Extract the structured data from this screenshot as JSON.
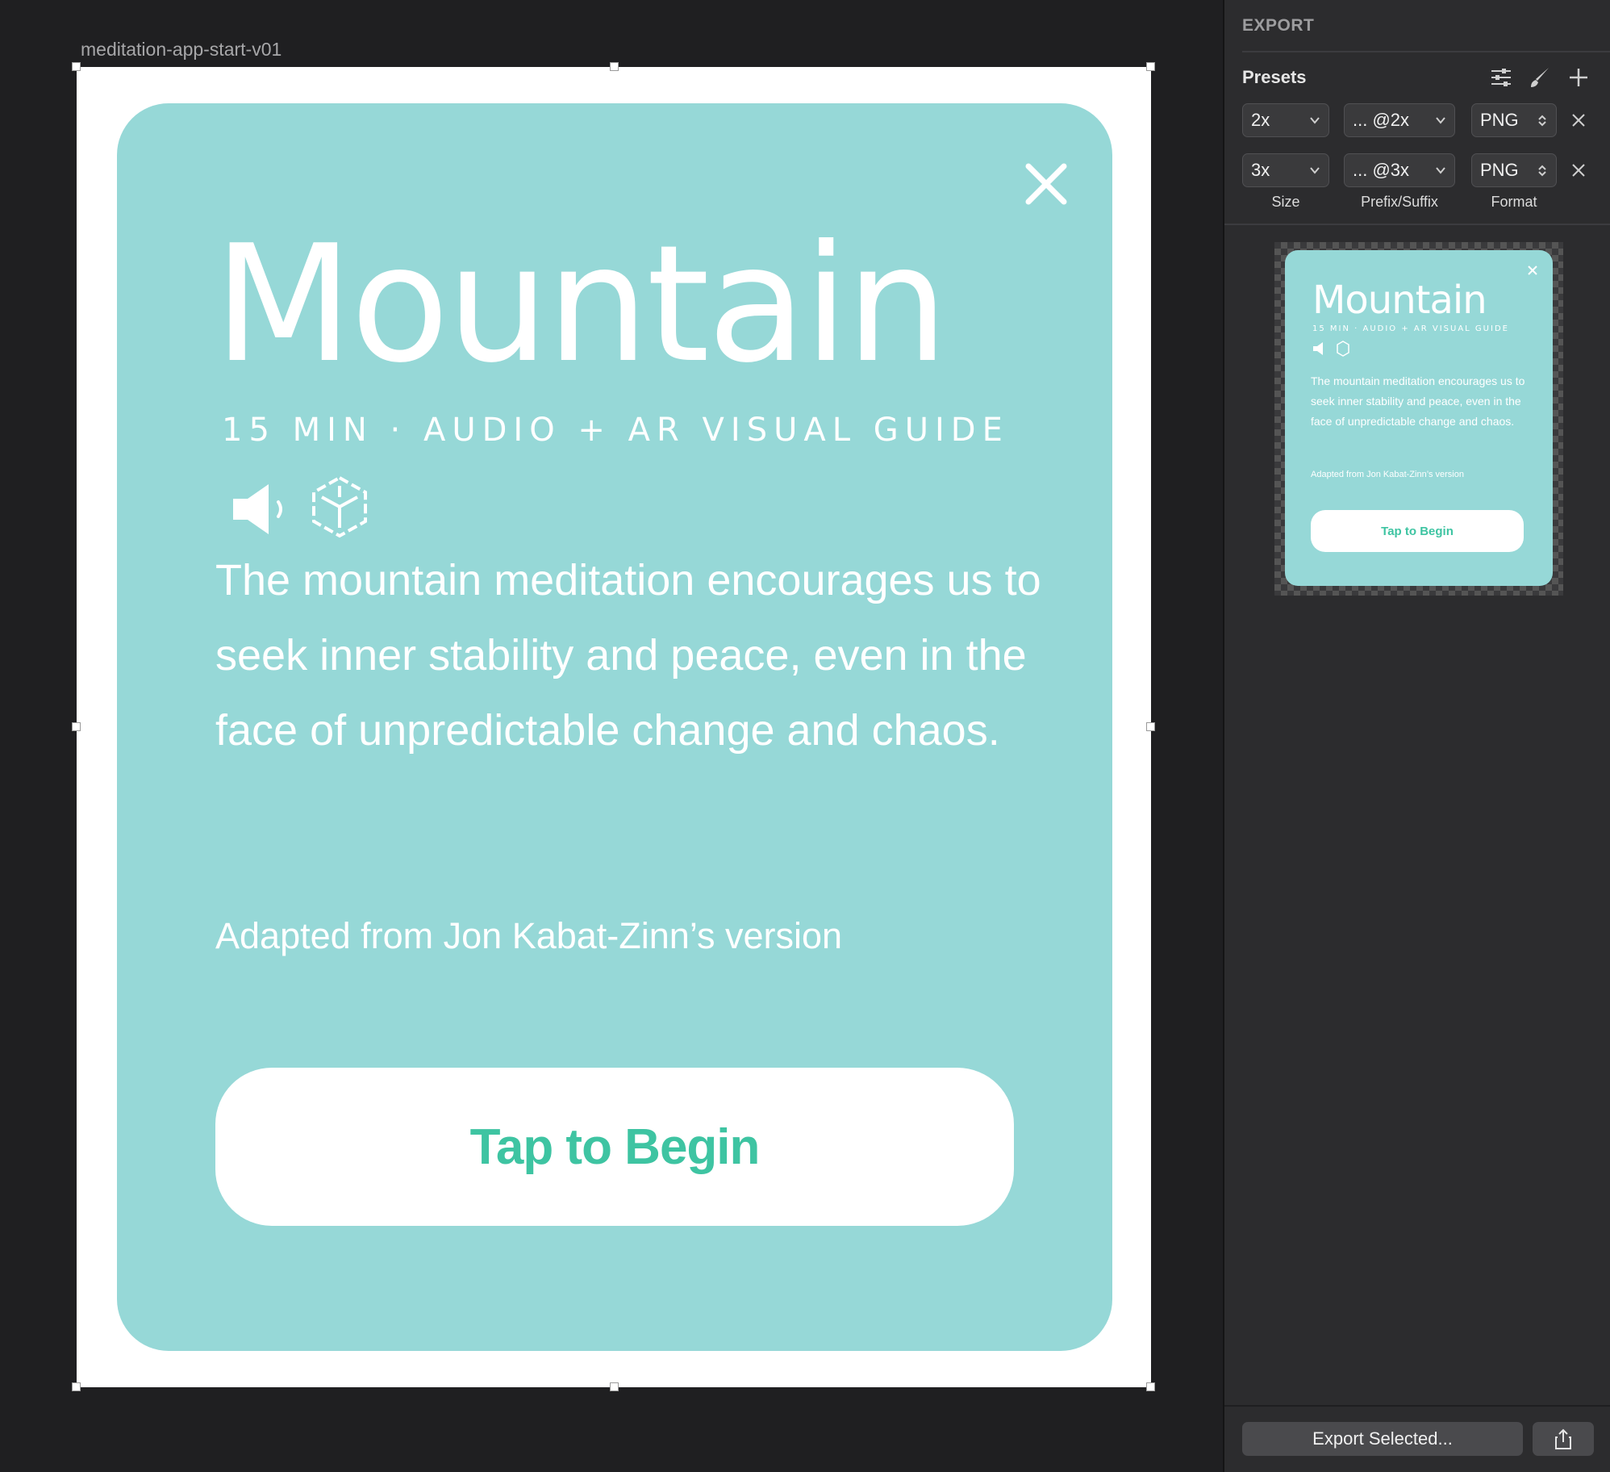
{
  "canvas": {
    "artboard_name": "meditation-app-start-v01",
    "card": {
      "title": "Mountain",
      "subtitle": "15 MIN · AUDIO + AR VISUAL GUIDE",
      "description": "The mountain meditation encourages us to seek inner stability and peace, even in the face of unpredictable change and chaos.",
      "credit": "Adapted from Jon Kabat-Zinn’s version",
      "button_label": "Tap to Begin",
      "icons": [
        "close-icon",
        "speaker-icon",
        "ar-cube-icon"
      ]
    }
  },
  "export_panel": {
    "header": "EXPORT",
    "presets_title": "Presets",
    "toolbar_icons": [
      "sliders-icon",
      "brush-icon",
      "plus-icon"
    ],
    "presets": [
      {
        "size": "2x",
        "suffix": "... @2x",
        "format": "PNG"
      },
      {
        "size": "3x",
        "suffix": "... @3x",
        "format": "PNG"
      }
    ],
    "columns": {
      "size": "Size",
      "suffix": "Prefix/Suffix",
      "format": "Format"
    },
    "preview": {
      "title": "Mountain",
      "subtitle": "15 MIN · AUDIO + AR VISUAL GUIDE",
      "description": "The mountain meditation encourages us to seek inner stability and peace, even in the face of unpredictable change and chaos.",
      "credit": "Adapted from Jon Kabat-Zinn’s version",
      "button_label": "Tap to Begin"
    },
    "export_button": "Export Selected...",
    "share_icon": "share-icon"
  },
  "colors": {
    "canvas_bg": "#1f1f21",
    "panel_bg": "#2c2c2e",
    "card_bg": "#96d8d7",
    "accent_green": "#3ec4a2",
    "white": "#ffffff"
  }
}
